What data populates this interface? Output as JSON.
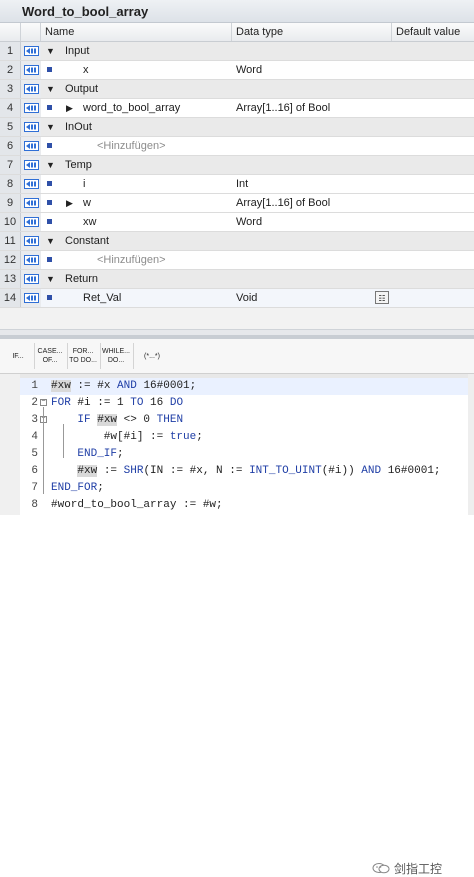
{
  "block": {
    "title": "Word_to_bool_array"
  },
  "table": {
    "columns": [
      "Name",
      "Data type",
      "Default value"
    ],
    "rows": [
      {
        "num": "1",
        "name": "Input",
        "type": "",
        "kind": "section",
        "expander": "down"
      },
      {
        "num": "2",
        "name": "x",
        "type": "Word",
        "kind": "var"
      },
      {
        "num": "3",
        "name": "Output",
        "type": "",
        "kind": "section",
        "expander": "down"
      },
      {
        "num": "4",
        "name": "word_to_bool_array",
        "type": "Array[1..16] of Bool",
        "kind": "var",
        "expander": "right"
      },
      {
        "num": "5",
        "name": "InOut",
        "type": "",
        "kind": "section",
        "expander": "down"
      },
      {
        "num": "6",
        "name": "<Hinzufügen>",
        "type": "",
        "kind": "placeholder"
      },
      {
        "num": "7",
        "name": "Temp",
        "type": "",
        "kind": "section",
        "expander": "down"
      },
      {
        "num": "8",
        "name": "i",
        "type": "Int",
        "kind": "var"
      },
      {
        "num": "9",
        "name": "w",
        "type": "Array[1..16] of Bool",
        "kind": "var",
        "expander": "right"
      },
      {
        "num": "10",
        "name": "xw",
        "type": "Word",
        "kind": "var"
      },
      {
        "num": "11",
        "name": "Constant",
        "type": "",
        "kind": "section",
        "expander": "down"
      },
      {
        "num": "12",
        "name": "<Hinzufügen>",
        "type": "",
        "kind": "placeholder"
      },
      {
        "num": "13",
        "name": "Return",
        "type": "",
        "kind": "section",
        "expander": "down"
      },
      {
        "num": "14",
        "name": "Ret_Val",
        "type": "Void",
        "kind": "var",
        "selected": true
      }
    ]
  },
  "toolbar": {
    "items": [
      {
        "label": "IF...",
        "name": "if-button"
      },
      {
        "label": "CASE... OF...",
        "name": "case-button"
      },
      {
        "label": "FOR... TO DO...",
        "name": "for-button"
      },
      {
        "label": "WHILE... DO...",
        "name": "while-button"
      },
      {
        "label": "(*...*)",
        "name": "comment-button"
      }
    ]
  },
  "code": {
    "lines": [
      {
        "num": "1",
        "text": "#xw := #x AND 16#0001;"
      },
      {
        "num": "2",
        "text": "FOR #i := 1 TO 16 DO"
      },
      {
        "num": "3",
        "text": "    IF #xw <> 0 THEN"
      },
      {
        "num": "4",
        "text": "        #w[#i] := true;"
      },
      {
        "num": "5",
        "text": "    END_IF;"
      },
      {
        "num": "6",
        "text": "    #xw := SHR(IN := #x, N := INT_TO_UINT(#i)) AND 16#0001;"
      },
      {
        "num": "7",
        "text": "END_FOR;"
      },
      {
        "num": "8",
        "text": "#word_to_bool_array := #w;"
      }
    ]
  },
  "watermark": {
    "text": "剑指工控"
  },
  "colors": {
    "keyword": "#1f3ea6",
    "io_icon": "#2f6fd6",
    "section_bg": "#eaeaea"
  }
}
